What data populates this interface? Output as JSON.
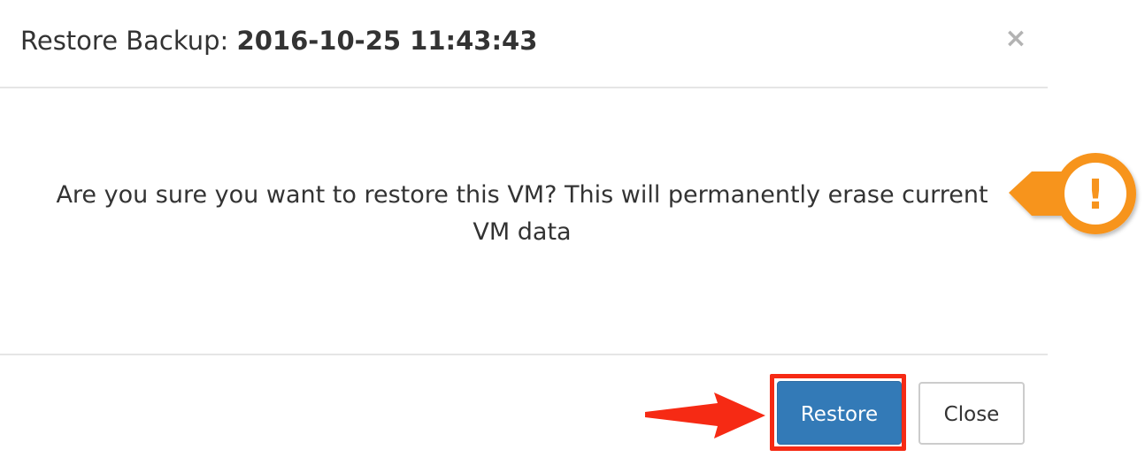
{
  "dialog": {
    "title_prefix": "Restore Backup: ",
    "title_value": "2016-10-25 11:43:43",
    "close_symbol": "×",
    "message": "Are you sure you want to restore this VM? This will permanently erase current VM data"
  },
  "footer": {
    "restore_label": "Restore",
    "close_label": "Close"
  },
  "annotations": {
    "warning_symbol": "!",
    "highlight_color": "#f62a14",
    "arrow_color": "#f62a14",
    "warning_color": "#f7941d"
  },
  "colors": {
    "primary": "#337ab7",
    "border": "#e5e5e5",
    "text": "#333333"
  },
  "icons": [
    "close-icon",
    "warning-callout-icon",
    "annotation-arrow-icon"
  ]
}
